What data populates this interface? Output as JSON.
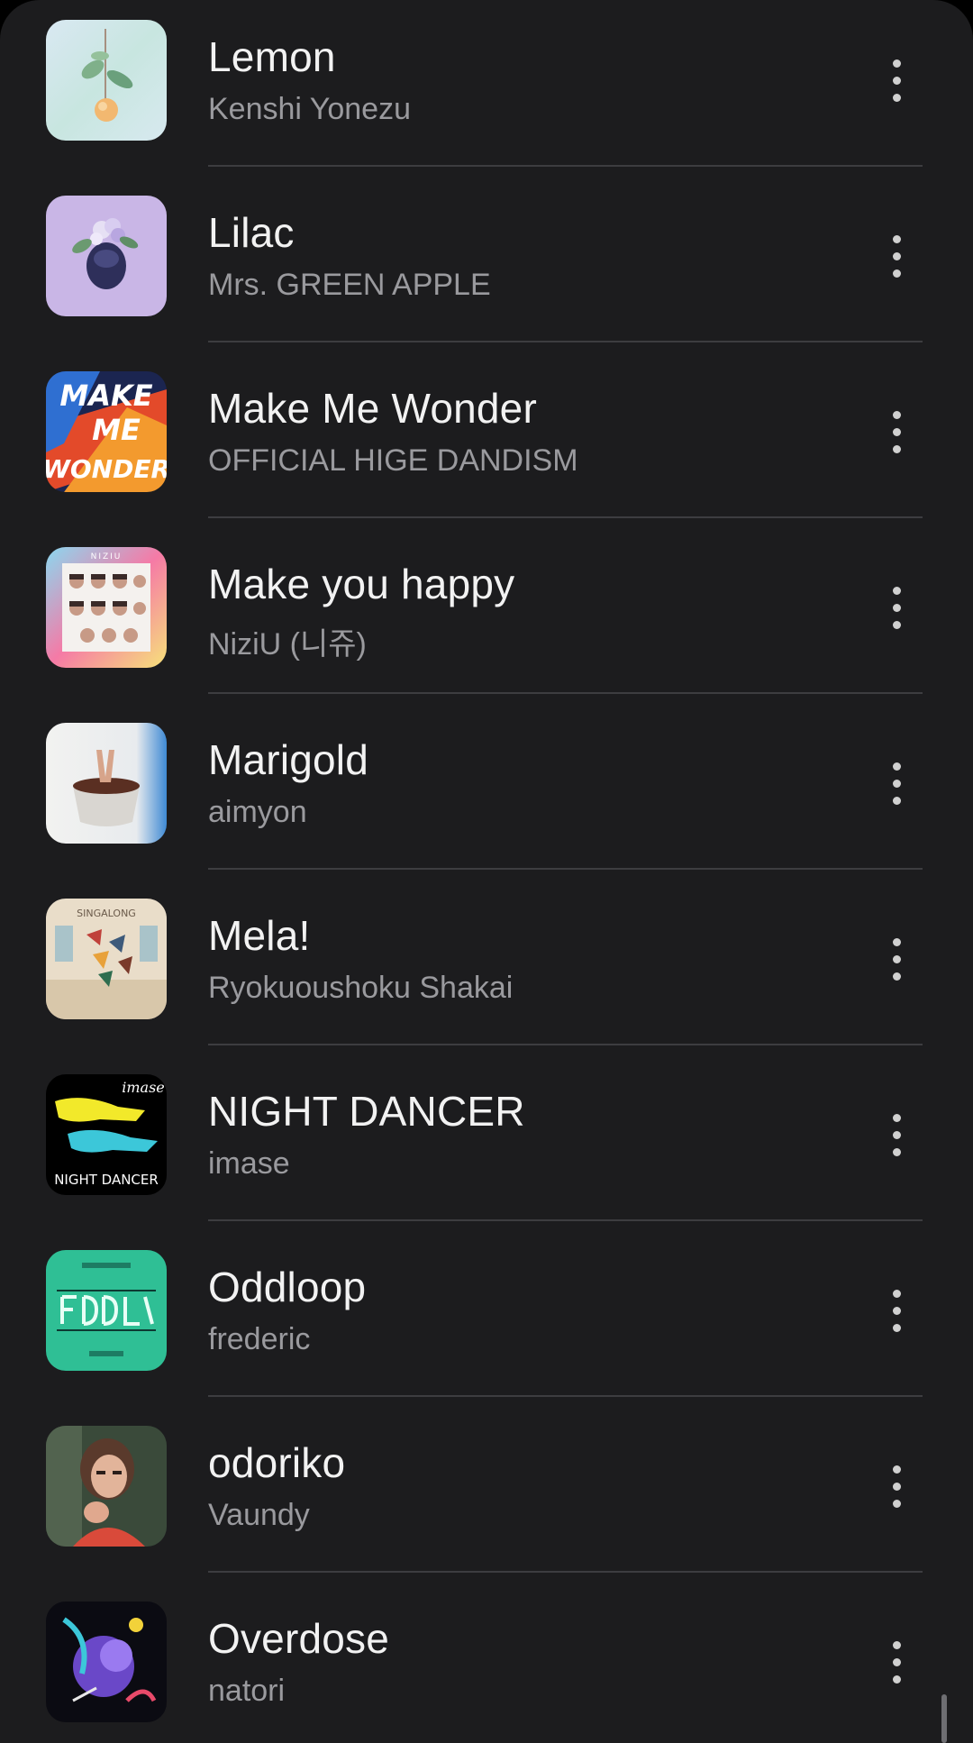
{
  "songs": [
    {
      "title": "Lemon",
      "artist": "Kenshi Yonezu",
      "art_icon": "lemon-cover-art",
      "more_icon": "more-vert-icon"
    },
    {
      "title": "Lilac",
      "artist": "Mrs. GREEN APPLE",
      "art_icon": "lilac-cover-art",
      "more_icon": "more-vert-icon"
    },
    {
      "title": "Make Me Wonder",
      "artist": "OFFICIAL HIGE DANDISM",
      "art_icon": "make-me-wonder-cover-art",
      "more_icon": "more-vert-icon",
      "art_text": [
        "MAKE",
        "ME",
        "WONDER"
      ]
    },
    {
      "title": "Make you happy",
      "artist": "NiziU (니쥬)",
      "art_icon": "make-you-happy-cover-art",
      "more_icon": "more-vert-icon",
      "art_text": [
        "NIZIU"
      ]
    },
    {
      "title": "Marigold",
      "artist": "aimyon",
      "art_icon": "marigold-cover-art",
      "more_icon": "more-vert-icon"
    },
    {
      "title": "Mela!",
      "artist": "Ryokuoushoku Shakai",
      "art_icon": "mela-cover-art",
      "more_icon": "more-vert-icon",
      "art_text": [
        "SINGALONG"
      ]
    },
    {
      "title": "NIGHT DANCER",
      "artist": "imase",
      "art_icon": "night-dancer-cover-art",
      "more_icon": "more-vert-icon",
      "art_text": [
        "imase",
        "NIGHT DANCER"
      ]
    },
    {
      "title": "Oddloop",
      "artist": "frederic",
      "art_icon": "oddloop-cover-art",
      "more_icon": "more-vert-icon"
    },
    {
      "title": "odoriko",
      "artist": "Vaundy",
      "art_icon": "odoriko-cover-art",
      "more_icon": "more-vert-icon"
    },
    {
      "title": "Overdose",
      "artist": "natori",
      "art_icon": "overdose-cover-art",
      "more_icon": "more-vert-icon"
    }
  ],
  "colors": {
    "background": "#1c1c1e",
    "title_text": "#f2f2f2",
    "artist_text": "#9a9a9e",
    "divider": "#3d3d40"
  }
}
